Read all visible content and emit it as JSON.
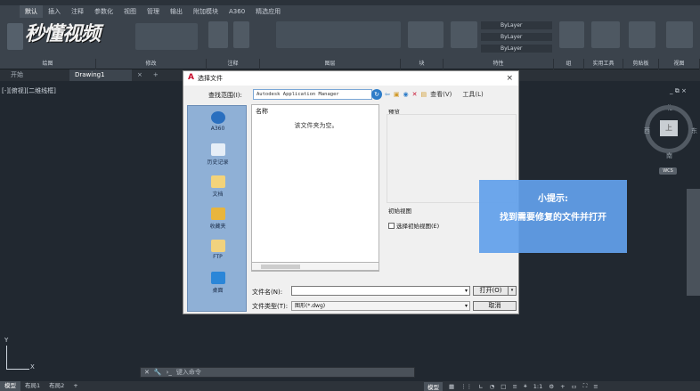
{
  "ribbon": {
    "tabs": [
      "默认",
      "插入",
      "注释",
      "参数化",
      "视图",
      "管理",
      "输出",
      "附加模块",
      "A360",
      "精选应用"
    ],
    "panels": [
      "绘图",
      "修改",
      "注释",
      "图层",
      "块",
      "特性",
      "组",
      "实用工具",
      "剪贴板",
      "视图"
    ],
    "bylayer": [
      "ByLayer",
      "ByLayer",
      "ByLayer"
    ]
  },
  "watermark": {
    "logo_text": "秒懂视频"
  },
  "doc_tabs": {
    "start": "开始",
    "drawing": "Drawing1",
    "close": "×",
    "add": "+"
  },
  "viewport": {
    "label": "[-][俯视][二维线框]",
    "controls": "_ ⧉ ×"
  },
  "viewcube": {
    "north": "北",
    "south": "南",
    "east": "东",
    "west": "西",
    "face": "上",
    "wcs": "WCS"
  },
  "dialog": {
    "title": "选择文件",
    "close": "×",
    "lookin_label": "查找范围(I):",
    "lookin_value": "Autodesk Application Manager",
    "toolbar": {
      "view": "查看(V)",
      "tools": "工具(L)"
    },
    "places": [
      "A360",
      "历史记录",
      "文档",
      "收藏夹",
      "FTP",
      "桌面"
    ],
    "file_list": {
      "header": "名称",
      "empty": "该文件夹为空。"
    },
    "preview_label": "预览",
    "initial_view_label": "初始视图",
    "initial_view_checkbox": "选择初始视图(E)",
    "filename_label": "文件名(N):",
    "filename_value": "",
    "filetype_label": "文件类型(T):",
    "filetype_value": "图形(*.dwg)",
    "open_button": "打开(O)",
    "cancel_button": "取消"
  },
  "tip": {
    "title": "小提示:",
    "body": "找到需要修复的文件并打开"
  },
  "ucs": {
    "x": "X",
    "y": "Y"
  },
  "command": {
    "placeholder": "键入命令"
  },
  "status": {
    "layout_tabs": [
      "模型",
      "布局1",
      "布局2"
    ],
    "model_indicator": "模型",
    "scale": "1:1"
  },
  "colors": {
    "tip_bg": "#62a0eb",
    "background": "#212830",
    "ribbon": "#3b434c",
    "dialog_bg": "#f0f0f0"
  }
}
